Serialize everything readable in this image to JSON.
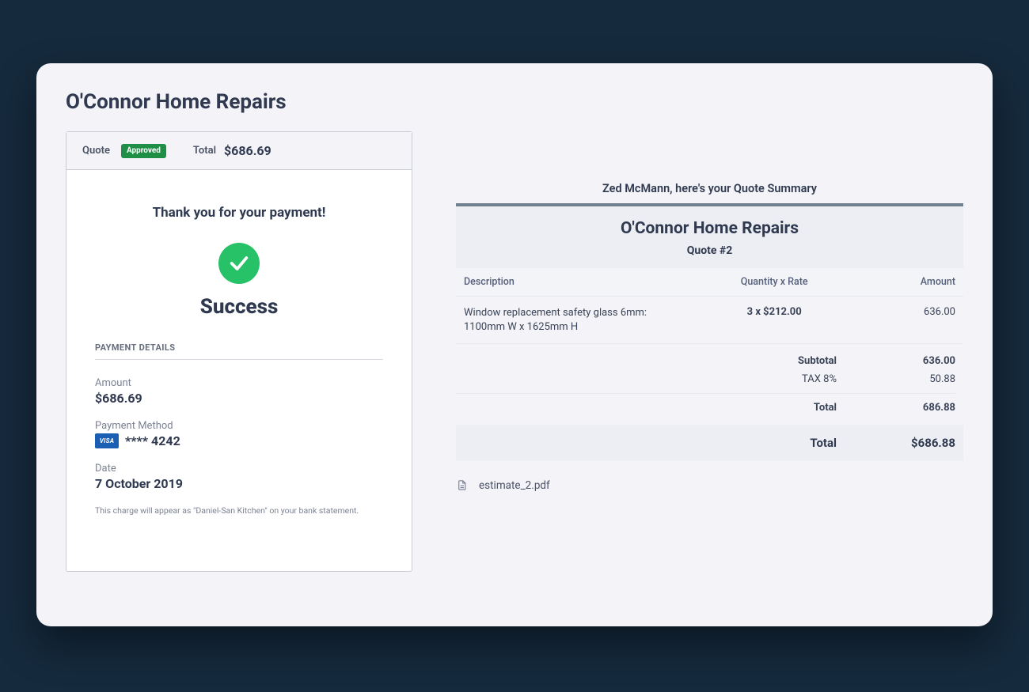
{
  "page_title": "O'Connor Home Repairs",
  "quote_card": {
    "quote_label": "Quote",
    "status_badge": "Approved",
    "total_label": "Total",
    "total_value": "$686.69",
    "thank_you": "Thank you for your payment!",
    "success": "Success",
    "payment_details_heading": "PAYMENT DETAILS",
    "amount_label": "Amount",
    "amount_value": "$686.69",
    "method_label": "Payment Method",
    "card_brand": "VISA",
    "card_mask": "**** 4242",
    "date_label": "Date",
    "date_value": "7 October 2019",
    "statement_note": "This charge will appear as \"Daniel-San Kitchen\" on your bank statement."
  },
  "summary": {
    "greeting": "Zed McMann, here's your Quote Summary",
    "business": "O'Connor Home Repairs",
    "quote_number": "Quote #2",
    "col_desc": "Description",
    "col_qr": "Quantity x Rate",
    "col_amt": "Amount",
    "line": {
      "description": "Window replacement safety glass 6mm: 1100mm W x 1625mm H",
      "qty_rate": "3 x $212.00",
      "amount": "636.00"
    },
    "subtotal_label": "Subtotal",
    "subtotal_value": "636.00",
    "tax_label": "TAX 8%",
    "tax_value": "50.88",
    "total_label": "Total",
    "total_value": "686.88",
    "grand_label": "Total",
    "grand_value": "$686.88",
    "attachment": "estimate_2.pdf"
  }
}
